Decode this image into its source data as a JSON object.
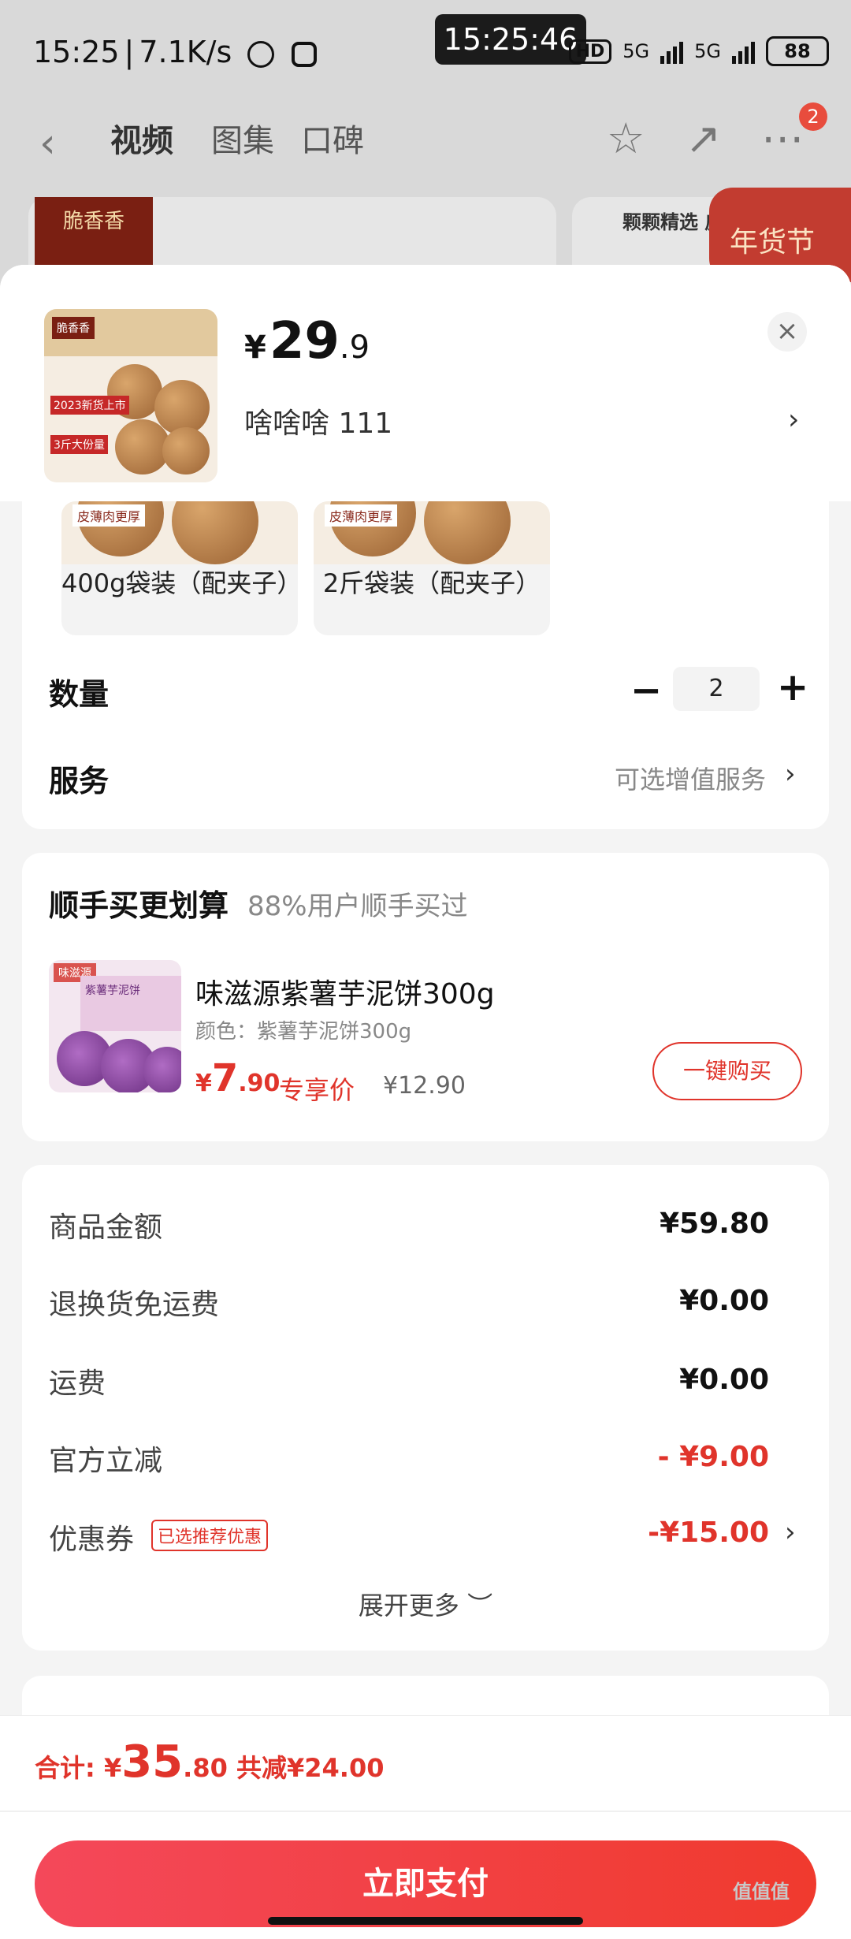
{
  "status_bar": {
    "time": "15:25",
    "separator": "|",
    "net_speed": "7.1K/s",
    "clock": "15:25:46",
    "hd": "HD",
    "net1": "5G",
    "net2": "5G",
    "battery": "88"
  },
  "nav": {
    "back": "‹",
    "tabs": [
      "视频",
      "图集",
      "口碑"
    ],
    "badge": "2",
    "star": "☆",
    "share": "↗",
    "more": "⋯"
  },
  "background": {
    "brand": "脆香香",
    "promo": "颗颗精选 皮",
    "festival": "年货节"
  },
  "product": {
    "price_currency": "¥",
    "price_int": "29",
    "price_dec": ".9",
    "selected_spec": "啥啥啥  111",
    "thumb_logo": "脆香香",
    "thumb_tag1": "2023新货上市",
    "thumb_tag2": "3斤大份量",
    "close": "×",
    "chevron": "›"
  },
  "options": [
    {
      "label": "400g袋装（配夹子）",
      "img_label": "皮薄肉更厚"
    },
    {
      "label": "2斤袋装（配夹子）",
      "img_label": "皮薄肉更厚"
    }
  ],
  "quantity": {
    "label": "数量",
    "minus": "−",
    "value": "2",
    "plus": "+"
  },
  "service": {
    "label": "服务",
    "hint": "可选增值服务",
    "chevron": "›"
  },
  "addon": {
    "title": "顺手买更划算",
    "subtitle": "88%用户顺手买过",
    "img_brand": "味滋源",
    "img_box": "紫薯芋泥饼",
    "name": "味滋源紫薯芋泥饼300g",
    "variant": "颜色：紫薯芋泥饼300g",
    "price_currency": "¥",
    "price_int": "7",
    "price_dec": ".90",
    "price_tag": "专享价",
    "orig_price": "¥12.90",
    "buy_label": "一键购买"
  },
  "fees": [
    {
      "label": "商品金额",
      "value": "¥59.80",
      "red": false
    },
    {
      "label": "退换货免运费",
      "value": "¥0.00",
      "red": false
    },
    {
      "label": "运费",
      "value": "¥0.00",
      "red": false
    },
    {
      "label": "官方立减",
      "value": "- ¥9.00",
      "red": true
    },
    {
      "label": "优惠券",
      "value": "-¥15.00",
      "red": true
    }
  ],
  "coupon_tag": "已选推荐优惠",
  "coupon_chevron": "›",
  "expand_label": "展开更多 ︶",
  "footer": {
    "total_label": "合计: ¥",
    "total_int": "35",
    "total_dec": ".80",
    "discount": " 共减¥24.00",
    "pay_label": "立即支付"
  },
  "watermark": "值值值",
  "colors": {
    "accent": "#e0342b",
    "pay_start": "#f4485a",
    "pay_end": "#f03a2e"
  }
}
